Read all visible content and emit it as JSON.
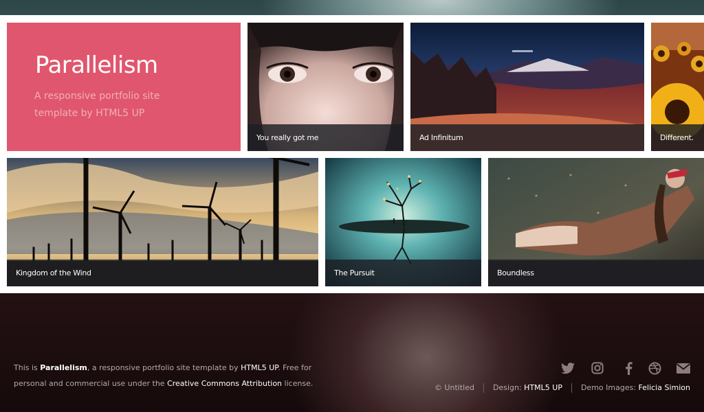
{
  "intro": {
    "title": "Parallelism",
    "subtitle": "A responsive portfolio site template by HTML5 UP"
  },
  "thumbnails": [
    {
      "caption": "You really got me"
    },
    {
      "caption": "Ad Infinitum"
    },
    {
      "caption": "Different."
    },
    {
      "caption": "Kingdom of the Wind"
    },
    {
      "caption": "The Pursuit"
    },
    {
      "caption": "Boundless"
    }
  ],
  "footer": {
    "text_prefix": "This is ",
    "site_name": "Parallelism",
    "text_middle": ", a responsive portfolio site template by ",
    "author_link": "HTML5 UP",
    "text_after_author": ". Free for personal and commercial use under the ",
    "license_link": "Creative Commons Attribution",
    "text_suffix": " license.",
    "icons": [
      "twitter-icon",
      "instagram-icon",
      "facebook-icon",
      "dribbble-icon",
      "envelope-icon"
    ],
    "copyright": "© Untitled",
    "design_label": "Design:",
    "design_link": "HTML5 UP",
    "images_label": "Demo Images:",
    "images_link": "Felicia Simion"
  },
  "colors": {
    "accent": "#e0566e",
    "caption_bg": "#1c1e24",
    "icon_color": "#8c7c7d"
  }
}
